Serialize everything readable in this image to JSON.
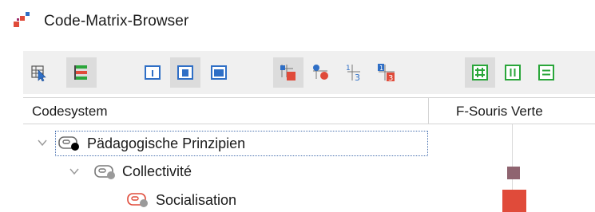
{
  "window": {
    "title": "Code-Matrix-Browser"
  },
  "toolbar": {
    "buttons": [
      {
        "name": "select-icon",
        "active": false
      },
      {
        "name": "color-bars-icon",
        "active": true
      },
      {
        "name": "view-narrow-icon",
        "active": false
      },
      {
        "name": "view-medium-icon",
        "active": true
      },
      {
        "name": "view-wide-icon",
        "active": false
      },
      {
        "name": "squares-icon",
        "active": true
      },
      {
        "name": "circles-icon",
        "active": false
      },
      {
        "name": "numbers-icon",
        "active": false
      },
      {
        "name": "number-squares-icon",
        "active": false
      },
      {
        "name": "grid-view-icon",
        "active": true
      },
      {
        "name": "columns-view-icon",
        "active": false
      },
      {
        "name": "rows-view-icon",
        "active": false
      }
    ]
  },
  "table": {
    "columns": {
      "codesystem": "Codesystem",
      "document": "F-Souris Verte"
    },
    "rows": [
      {
        "label": "Pädagogische Prinzipien",
        "level": 0,
        "expanded": true,
        "icon_dot_color": "#000000"
      },
      {
        "label": "Collectivité",
        "level": 1,
        "expanded": true,
        "icon_dot_color": "#9a9a9a",
        "cell": {
          "color": "#8f6470",
          "size": "small"
        }
      },
      {
        "label": "Socialisation",
        "level": 2,
        "expanded": false,
        "icon_dot_color": "#9a9a9a",
        "icon_color": "#e04b3a",
        "cell": {
          "color": "#e04b3a",
          "size": "large"
        }
      }
    ]
  },
  "colors": {
    "toolbar_green": "#2aa63a",
    "toolbar_blue": "#2f6fc6",
    "toolbar_red": "#e04b3a",
    "select_bg": "#dcdcdc"
  }
}
